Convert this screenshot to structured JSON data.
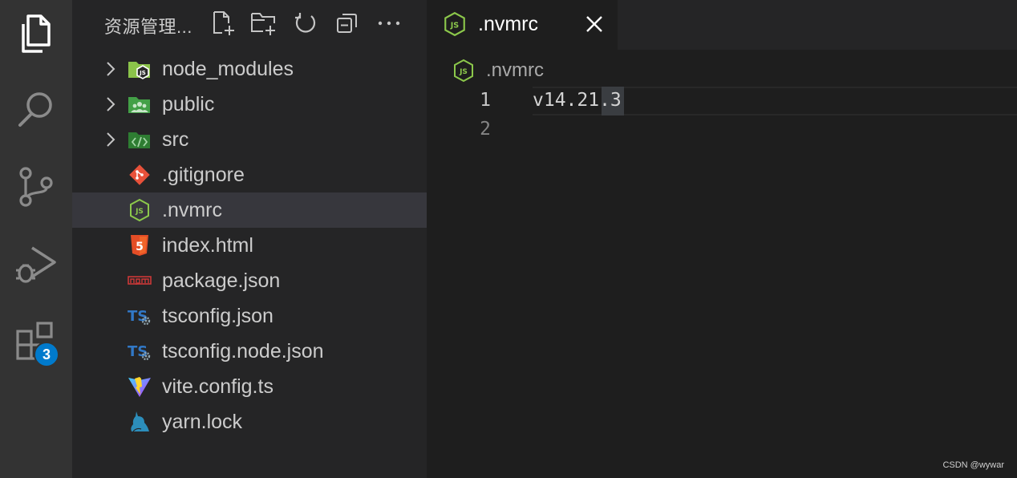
{
  "activity_bar": {
    "items": [
      {
        "name": "explorer",
        "icon": "files-icon"
      },
      {
        "name": "search",
        "icon": "search-icon"
      },
      {
        "name": "source-control",
        "icon": "source-control-icon"
      },
      {
        "name": "run-debug",
        "icon": "run-debug-icon"
      },
      {
        "name": "extensions",
        "icon": "extensions-icon"
      }
    ],
    "extensions_badge": "3"
  },
  "sidebar": {
    "title": "资源管理...",
    "actions": [
      "new-file-icon",
      "new-folder-icon",
      "refresh-icon",
      "collapse-all-icon",
      "more-icon"
    ],
    "items": [
      {
        "label": "node_modules",
        "type": "folder",
        "icon": "node-folder-icon"
      },
      {
        "label": "public",
        "type": "folder",
        "icon": "public-folder-icon"
      },
      {
        "label": "src",
        "type": "folder",
        "icon": "src-folder-icon"
      },
      {
        "label": ".gitignore",
        "type": "file",
        "icon": "git-icon"
      },
      {
        "label": ".nvmrc",
        "type": "file",
        "icon": "nodejs-icon",
        "selected": true
      },
      {
        "label": "index.html",
        "type": "file",
        "icon": "html5-icon"
      },
      {
        "label": "package.json",
        "type": "file",
        "icon": "npm-icon"
      },
      {
        "label": "tsconfig.json",
        "type": "file",
        "icon": "tsconfig-icon"
      },
      {
        "label": "tsconfig.node.json",
        "type": "file",
        "icon": "tsconfig-icon"
      },
      {
        "label": "vite.config.ts",
        "type": "file",
        "icon": "vite-icon"
      },
      {
        "label": "yarn.lock",
        "type": "file",
        "icon": "yarn-icon"
      }
    ]
  },
  "editor": {
    "tab": {
      "label": ".nvmrc",
      "icon": "nodejs-icon"
    },
    "breadcrumb": {
      "label": ".nvmrc",
      "icon": "nodejs-icon"
    },
    "lines": [
      {
        "number": "1",
        "text": "v14.21.3"
      },
      {
        "number": "2",
        "text": ""
      }
    ]
  },
  "watermark": "CSDN @wywar",
  "colors": {
    "activity_bar": "#333333",
    "sidebar": "#252526",
    "editor": "#1e1e1e",
    "selected_row": "#37373d",
    "badge": "#007acc",
    "node_green": "#8cc84b"
  }
}
